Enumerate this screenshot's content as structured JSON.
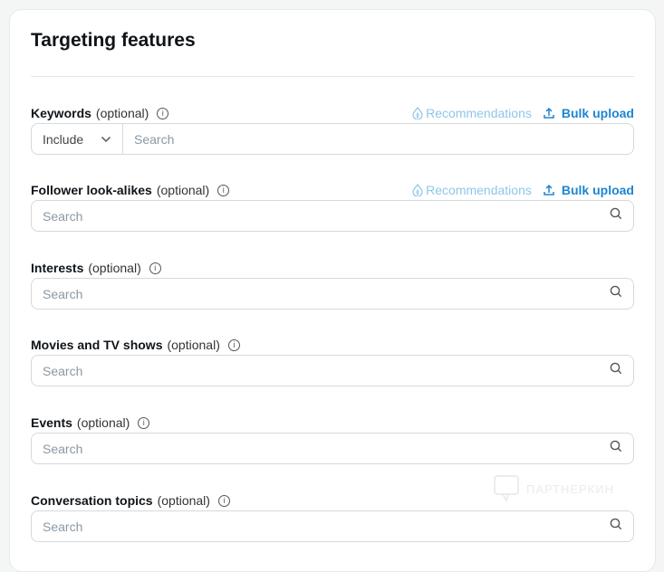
{
  "title": "Targeting features",
  "recommendations_label": "Recommendations",
  "bulk_upload_label": "Bulk upload",
  "placeholder": "Search",
  "optional": "(optional)",
  "watermark": "ПАРТНЕРКИН",
  "fields": [
    {
      "label": "Keywords",
      "mode": "Include",
      "actions": true
    },
    {
      "label": "Follower look-alikes",
      "actions": true
    },
    {
      "label": "Interests"
    },
    {
      "label": "Movies and TV shows"
    },
    {
      "label": "Events"
    },
    {
      "label": "Conversation topics"
    }
  ],
  "colors": {
    "link": "#1d85d0",
    "link_disabled": "#8fc6ea"
  }
}
